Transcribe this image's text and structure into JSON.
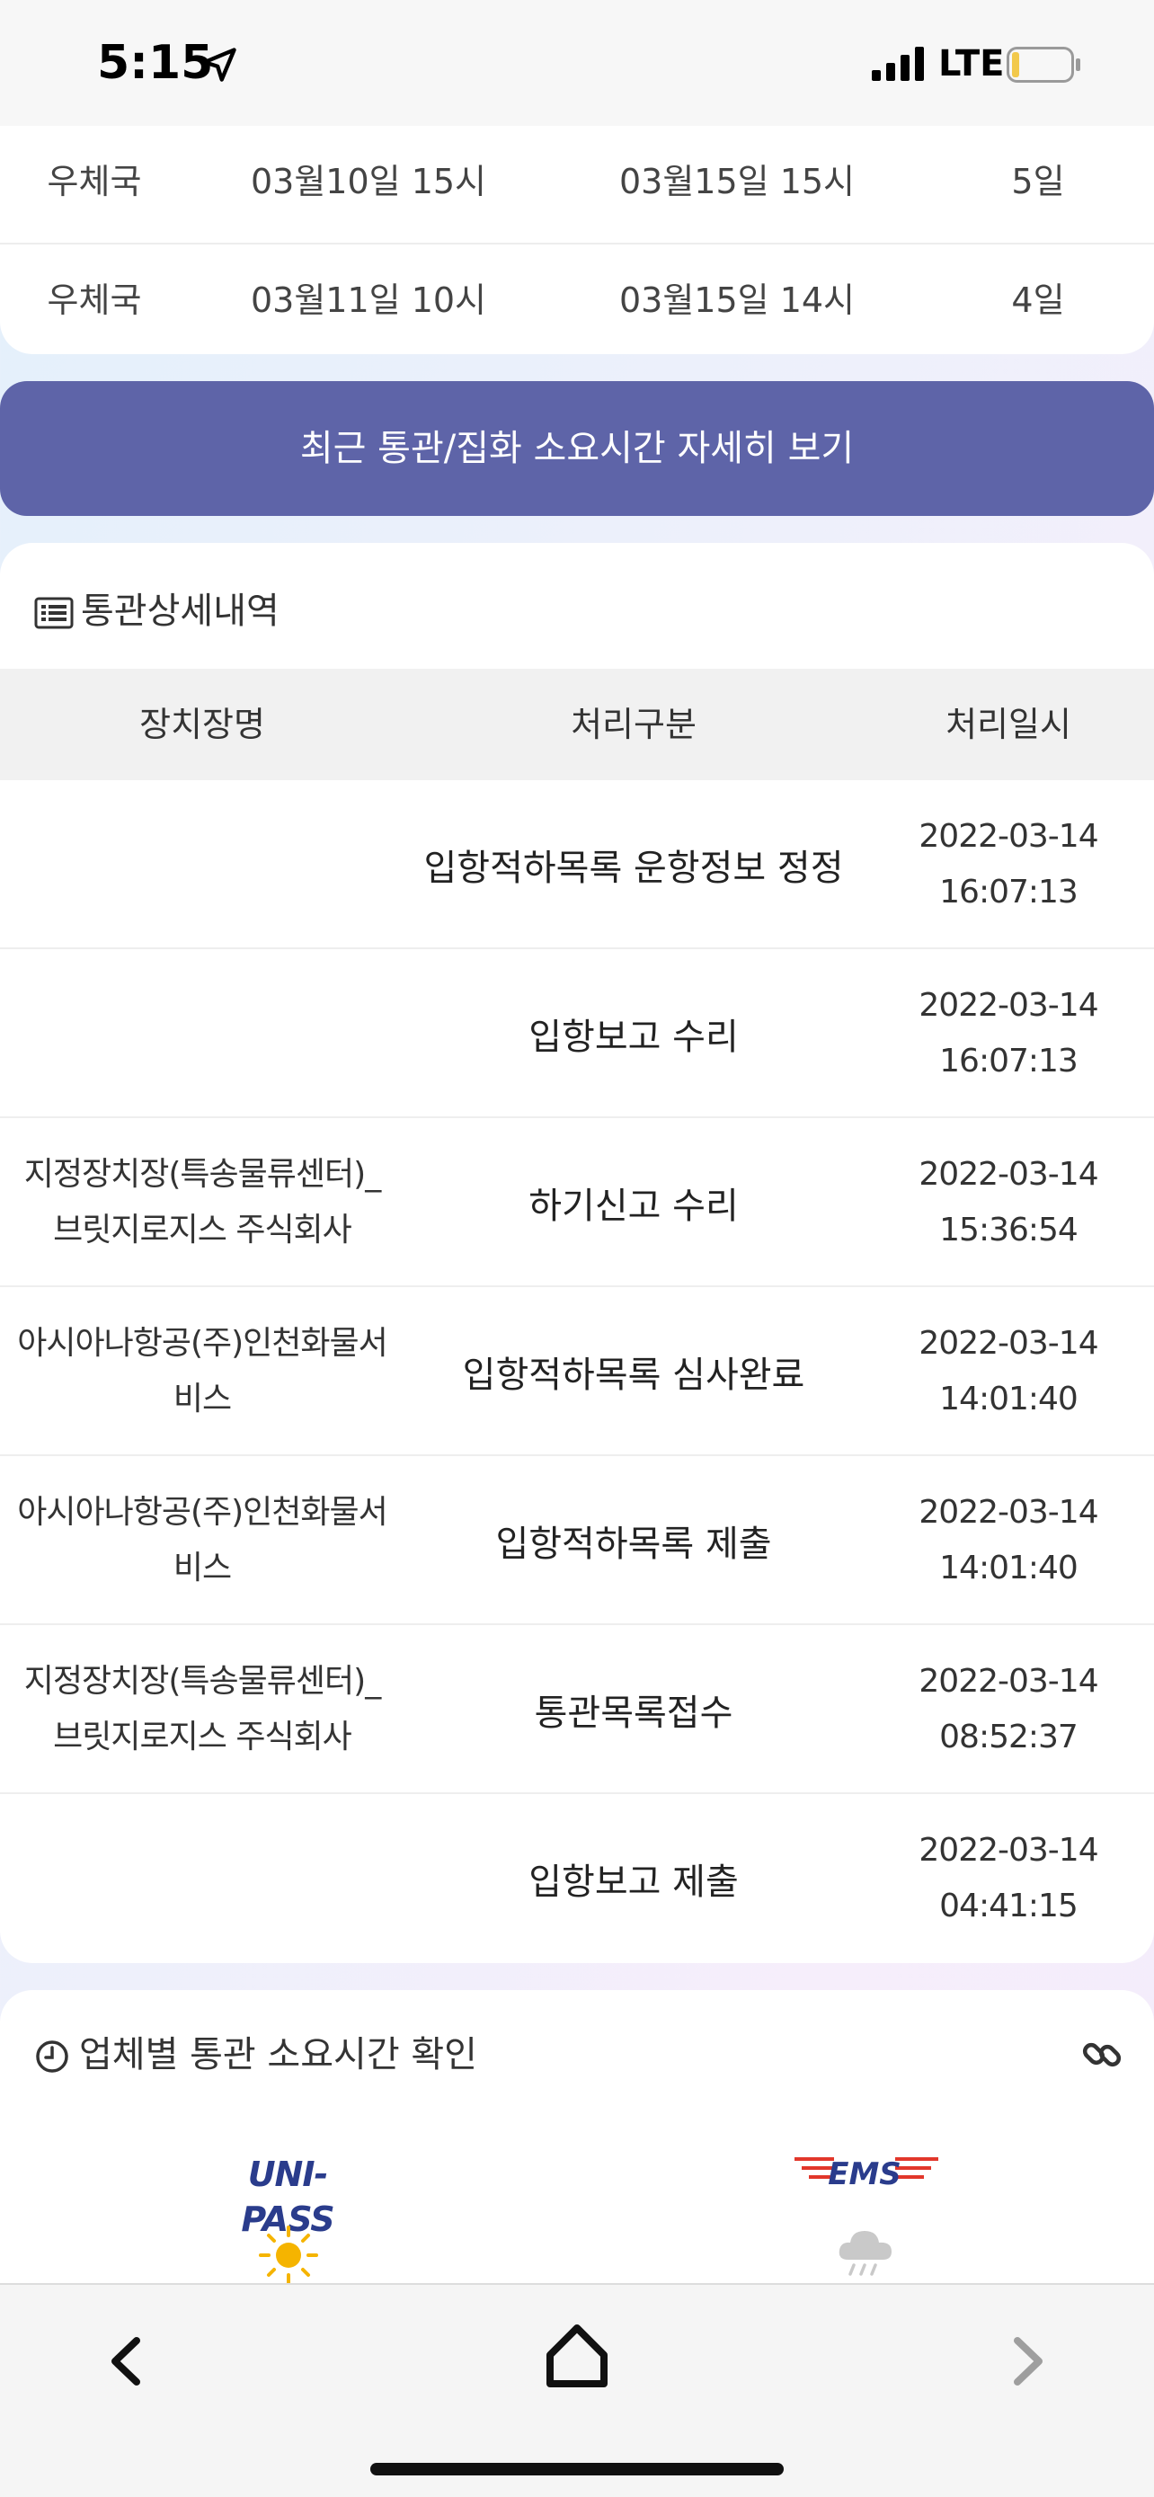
{
  "status_bar": {
    "time": "5:15",
    "network": "LTE",
    "icons": [
      "location-arrow-icon",
      "signal-bars-icon",
      "battery-low-icon"
    ]
  },
  "transit_table": {
    "rows": [
      {
        "carrier": "우체국",
        "start": "03월10일 15시",
        "end": "03월15일 15시",
        "duration": "5일"
      },
      {
        "carrier": "우체국",
        "start": "03월11일 10시",
        "end": "03월15일 14시",
        "duration": "4일"
      }
    ]
  },
  "detail_button": {
    "label": "최근 통관/집화 소요시간 자세히 보기"
  },
  "customs_detail": {
    "title": "통관상세내역",
    "icon": "list-icon",
    "columns": [
      "장치장명",
      "처리구분",
      "처리일시"
    ],
    "rows": [
      {
        "location": "",
        "process": "입항적하목록 운항정보 정정",
        "date": "2022-03-14",
        "time": "16:07:13"
      },
      {
        "location": "",
        "process": "입항보고 수리",
        "date": "2022-03-14",
        "time": "16:07:13"
      },
      {
        "location_line1": "지정장치장(특송물류센터)_",
        "location_line2": "브릿지로지스 주식회사",
        "process": "하기신고 수리",
        "date": "2022-03-14",
        "time": "15:36:54"
      },
      {
        "location_line1": "아시아나항공(주)인천화물서",
        "location_line2": "비스",
        "process": "입항적하목록 심사완료",
        "date": "2022-03-14",
        "time": "14:01:40"
      },
      {
        "location_line1": "아시아나항공(주)인천화물서",
        "location_line2": "비스",
        "process": "입항적하목록 제출",
        "date": "2022-03-14",
        "time": "14:01:40"
      },
      {
        "location_line1": "지정장치장(특송물류센터)_",
        "location_line2": "브릿지로지스 주식회사",
        "process": "통관목록접수",
        "date": "2022-03-14",
        "time": "08:52:37"
      },
      {
        "location": "",
        "process": "입항보고 제출",
        "date": "2022-03-14",
        "time": "04:41:15"
      }
    ]
  },
  "company_section": {
    "title": "업체별 통관 소요시간 확인",
    "icons": [
      "clock-icon",
      "link-icon"
    ],
    "logos": {
      "unipass": "UNI-PASS",
      "ems": "EMS"
    },
    "weather_icons": [
      "sun-icon",
      "rain-cloud-icon"
    ]
  },
  "toolbar": {
    "icons": [
      "back-chevron-icon",
      "home-icon",
      "forward-chevron-icon"
    ]
  },
  "colors": {
    "button": "#5e64a8",
    "sun": "#f5b400",
    "unipass_blue": "#2a3c8c",
    "ems_red": "#e2372b"
  }
}
